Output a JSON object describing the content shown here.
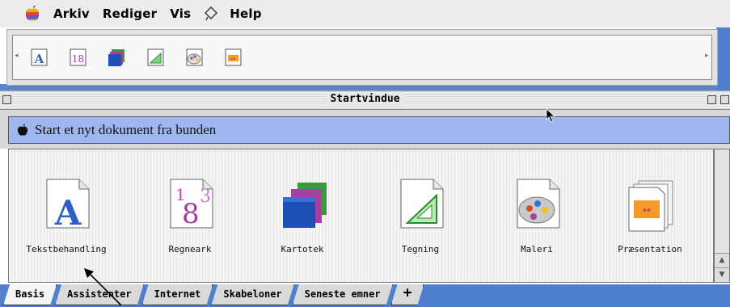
{
  "menubar": {
    "items": [
      "Arkiv",
      "Rediger",
      "Vis",
      "Help"
    ]
  },
  "toolbar": {
    "buttons": [
      "text-doc-button",
      "spreadsheet-button",
      "database-button",
      "drawing-button",
      "paint-button",
      "presentation-button"
    ]
  },
  "window": {
    "title": "Startvindue"
  },
  "header": {
    "text": "Start et nyt dokument fra bunden"
  },
  "documents": [
    {
      "label": "Tekstbehandling",
      "icon": "text-document-icon"
    },
    {
      "label": "Regneark",
      "icon": "spreadsheet-icon"
    },
    {
      "label": "Kartotek",
      "icon": "database-icon"
    },
    {
      "label": "Tegning",
      "icon": "drawing-icon"
    },
    {
      "label": "Maleri",
      "icon": "paint-palette-icon"
    },
    {
      "label": "Præsentation",
      "icon": "presentation-icon"
    }
  ],
  "tabs": [
    {
      "label": "Basis",
      "active": true
    },
    {
      "label": "Assistenter",
      "active": false
    },
    {
      "label": "Internet",
      "active": false
    },
    {
      "label": "Skabeloner",
      "active": false
    },
    {
      "label": "Seneste emner",
      "active": false
    },
    {
      "label": "+",
      "active": false
    }
  ],
  "colors": {
    "accent_blue": "#4f7fce",
    "header_blue": "#9fb7ef"
  }
}
